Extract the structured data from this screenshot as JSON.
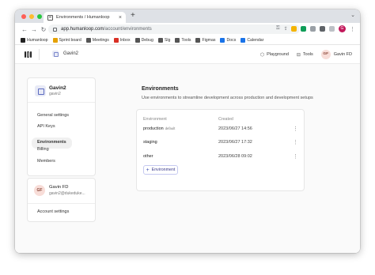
{
  "browser": {
    "tab_title": "Environments / Humanloop",
    "url_domain": "app.humanloop.com",
    "url_path": "/account/environments",
    "profile_initial": "G",
    "bookmarks": [
      {
        "label": "Humanloop",
        "color": "#222222"
      },
      {
        "label": "Sprint board",
        "color": "#e5a100"
      },
      {
        "label": "Meetings",
        "color": "#555555"
      },
      {
        "label": "Inbox",
        "color": "#d93025"
      },
      {
        "label": "Debug",
        "color": "#555555"
      },
      {
        "label": "Slg",
        "color": "#555555"
      },
      {
        "label": "Tools",
        "color": "#555555"
      },
      {
        "label": "Figmas",
        "color": "#555555"
      },
      {
        "label": "Docs",
        "color": "#1a73e8"
      },
      {
        "label": "Calendar",
        "color": "#1a73e8"
      }
    ]
  },
  "header": {
    "org_name": "Gavin2",
    "playground_label": "Playground",
    "tools_label": "Tools",
    "user_initials": "GF",
    "user_name": "Gavin FD"
  },
  "sidebar": {
    "org_name": "Gavin2",
    "org_handle": "gavin2",
    "items": [
      {
        "label": "General settings",
        "active": false
      },
      {
        "label": "API Keys",
        "active": false
      },
      {
        "label": "Environments",
        "active": true
      },
      {
        "label": "Billing",
        "active": false
      },
      {
        "label": "Members",
        "active": false
      }
    ]
  },
  "user_card": {
    "initials": "GF",
    "name": "Gavin FD",
    "email": "gavin2@dukeduke...",
    "account_settings": "Account settings"
  },
  "main": {
    "title": "Environments",
    "description": "Use environments to streamline development across production and development setups",
    "columns": [
      "Environment",
      "Created"
    ],
    "rows": [
      {
        "name": "production",
        "badge": "default",
        "created": "2023/06/27 14:56"
      },
      {
        "name": "staging",
        "badge": "",
        "created": "2023/06/27 17:32"
      },
      {
        "name": "other",
        "badge": "",
        "created": "2023/06/28 09:02"
      }
    ],
    "add_button": "Environment"
  }
}
